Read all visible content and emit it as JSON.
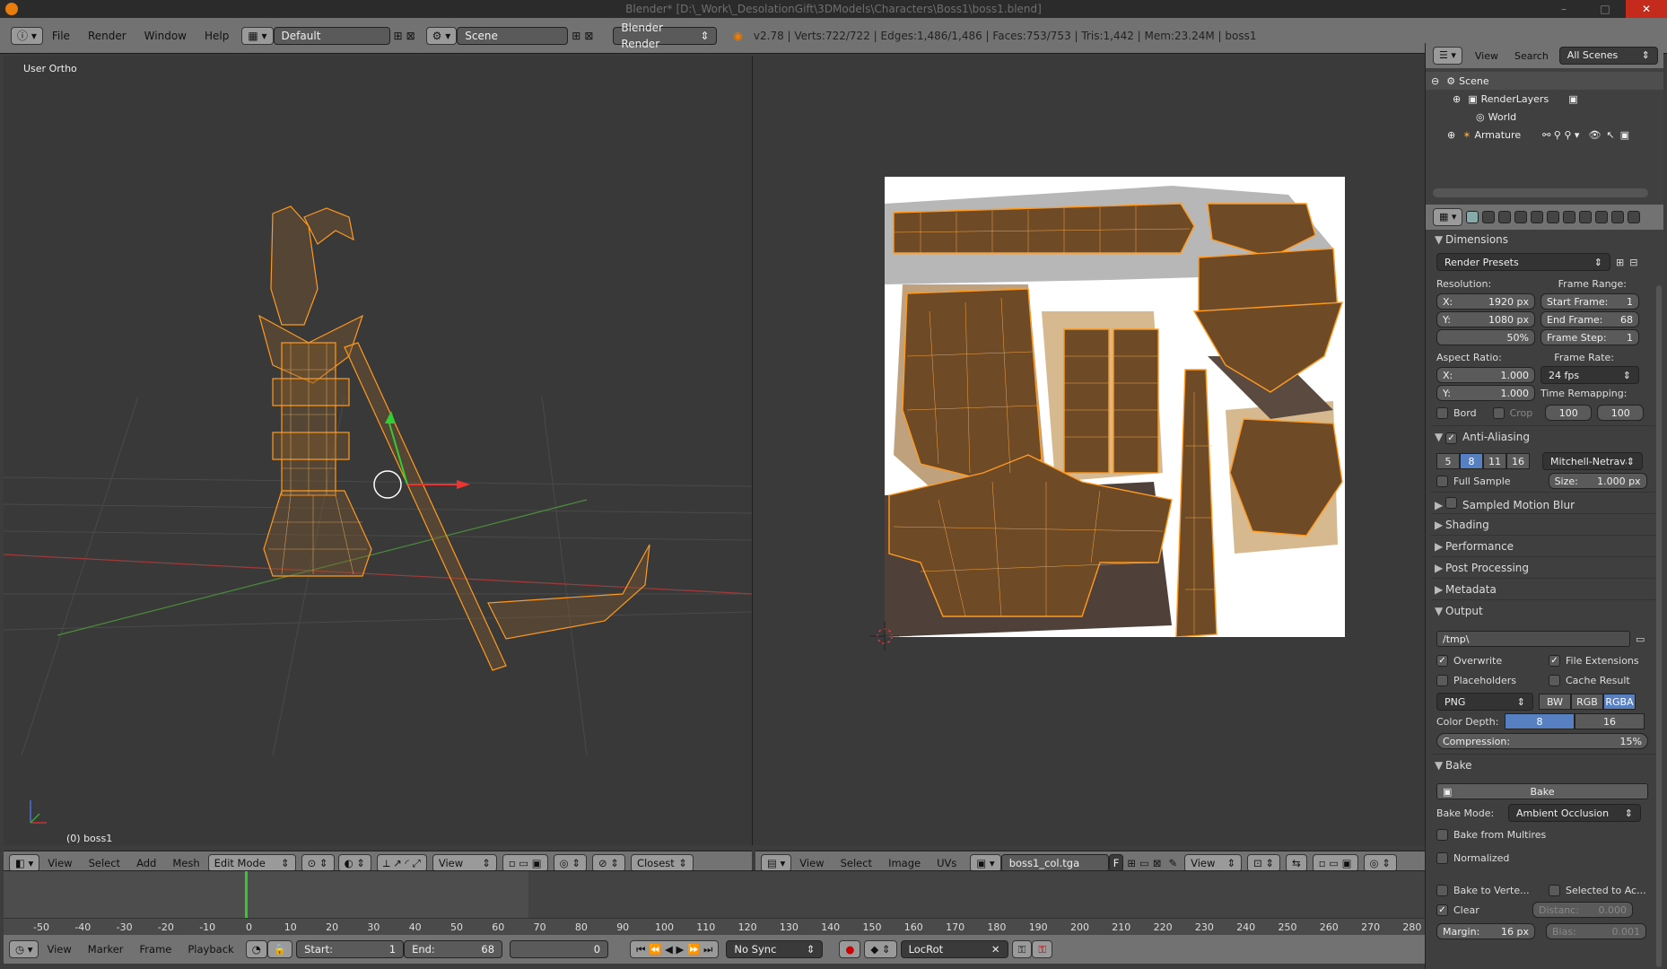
{
  "window": {
    "title": "Blender* [D:\\_Work\\_DesolationGift\\3DModels\\Characters\\Boss1\\boss1.blend]"
  },
  "menubar": {
    "menu": [
      "File",
      "Render",
      "Window",
      "Help"
    ],
    "layout": "Default",
    "scene": "Scene",
    "engine": "Blender Render",
    "stats": "v2.78 | Verts:722/722 | Edges:1,486/1,486 | Faces:753/753 | Tris:1,442 | Mem:23.24M | boss1"
  },
  "viewport3d": {
    "label": "User Ortho",
    "object_label": "(0) boss1",
    "header": {
      "menu": [
        "View",
        "Select",
        "Add",
        "Mesh"
      ],
      "mode": "Edit Mode",
      "orientation": "View",
      "snap": "Closest"
    }
  },
  "uv_editor": {
    "header": {
      "menu": [
        "View",
        "Select",
        "Image",
        "UVs"
      ],
      "image": "boss1_col.tga",
      "f": "F",
      "view": "View"
    }
  },
  "timeline": {
    "ticks": [
      "-50",
      "-40",
      "-30",
      "-20",
      "-10",
      "0",
      "10",
      "20",
      "30",
      "40",
      "50",
      "60",
      "70",
      "80",
      "90",
      "100",
      "110",
      "120",
      "130",
      "140",
      "150",
      "160",
      "170",
      "180",
      "190",
      "200",
      "210",
      "220",
      "230",
      "240",
      "250",
      "260",
      "270",
      "280"
    ],
    "menu": [
      "View",
      "Marker",
      "Frame",
      "Playback"
    ],
    "start_label": "Start:",
    "start": "1",
    "end_label": "End:",
    "end": "68",
    "current": "0",
    "sync": "No Sync",
    "keying": "LocRot"
  },
  "outliner": {
    "menu": [
      "View",
      "Search"
    ],
    "filter": "All Scenes",
    "items": [
      "Scene",
      "RenderLayers",
      "World",
      "Armature"
    ]
  },
  "properties": {
    "dimensions": {
      "title": "Dimensions",
      "presets": "Render Presets",
      "resolution_label": "Resolution:",
      "res_x_label": "X:",
      "res_x": "1920 px",
      "res_y_label": "Y:",
      "res_y": "1080 px",
      "res_pct": "50%",
      "frame_range_label": "Frame Range:",
      "start_frame_label": "Start Frame:",
      "start_frame": "1",
      "end_frame_label": "End Frame:",
      "end_frame": "68",
      "frame_step_label": "Frame Step:",
      "frame_step": "1",
      "aspect_label": "Aspect Ratio:",
      "aspect_x_label": "X:",
      "aspect_x": "1.000",
      "aspect_y_label": "Y:",
      "aspect_y": "1.000",
      "frame_rate_label": "Frame Rate:",
      "frame_rate": "24 fps",
      "time_remap_label": "Time Remapping:",
      "remap_old": "100",
      "remap_new": "100",
      "bord": "Bord",
      "crop": "Crop"
    },
    "anti_aliasing": {
      "title": "Anti-Aliasing",
      "samples": [
        "5",
        "8",
        "11",
        "16"
      ],
      "filter": "Mitchell-Netravali",
      "full_sample": "Full Sample",
      "size_label": "Size:",
      "size": "1.000 px"
    },
    "collapsed_sections": [
      "Sampled Motion Blur",
      "Shading",
      "Performance",
      "Post Processing",
      "Metadata"
    ],
    "output": {
      "title": "Output",
      "path": "/tmp\\",
      "overwrite": "Overwrite",
      "file_extensions": "File Extensions",
      "placeholders": "Placeholders",
      "cache_result": "Cache Result",
      "format": "PNG",
      "color_modes": [
        "BW",
        "RGB",
        "RGBA"
      ],
      "color_depth_label": "Color Depth:",
      "color_depths": [
        "8",
        "16"
      ],
      "compression_label": "Compression:",
      "compression": "15%"
    },
    "bake": {
      "title": "Bake",
      "button": "Bake",
      "mode_label": "Bake Mode:",
      "mode": "Ambient Occlusion",
      "from_multires": "Bake from Multires",
      "normalized": "Normalized",
      "bake_to_vertex": "Bake to Verte...",
      "selected_to_active": "Selected to Ac...",
      "clear": "Clear",
      "distance_label": "Distanc:",
      "distance": "0.000",
      "margin_label": "Margin:",
      "margin": "16 px",
      "bias_label": "Bias:",
      "bias": "0.001"
    }
  }
}
